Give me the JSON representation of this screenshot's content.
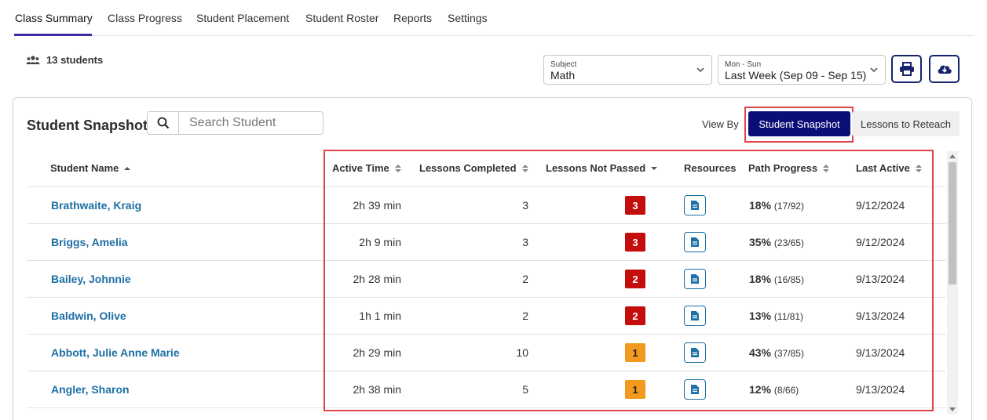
{
  "tabs": [
    {
      "label": "Class Summary",
      "active": true
    },
    {
      "label": "Class Progress"
    },
    {
      "label": "Student Placement"
    },
    {
      "label": "Student Roster"
    },
    {
      "label": "Reports"
    },
    {
      "label": "Settings"
    }
  ],
  "student_count": "13 students",
  "subject": {
    "label": "Subject",
    "value": "Math"
  },
  "range": {
    "label": "Mon - Sun",
    "value": "Last Week (Sep 09 - Sep 15)"
  },
  "icons": {
    "print": "print-icon",
    "download": "cloud-download-icon",
    "people": "people-icon",
    "search": "search-icon",
    "resource": "document-icon"
  },
  "colors": {
    "accent": "#3f2aa8",
    "primary_button": "#0c0e78",
    "link": "#1d6fa5",
    "badge_red": "#c40d0d",
    "badge_orange": "#f29a1d",
    "highlight": "#e0434b"
  },
  "snapshot": {
    "title": "Student Snapshot",
    "search_placeholder": "Search Student",
    "view_by_label": "View By",
    "view_options": [
      "Student Snapshot",
      "Lessons to Reteach"
    ],
    "active_view": "Student Snapshot",
    "columns": [
      "Student Name",
      "Active Time",
      "Lessons Completed",
      "Lessons Not Passed",
      "Resources",
      "Path Progress",
      "Last Active"
    ],
    "rows": [
      {
        "name": "Brathwaite, Kraig",
        "active_time": "2h 39 min",
        "completed": "3",
        "not_passed": "3",
        "badge": "red",
        "progress": "18%",
        "progress_frac": "(17/92)",
        "last_active": "9/12/2024"
      },
      {
        "name": "Briggs, Amelia",
        "active_time": "2h 9 min",
        "completed": "3",
        "not_passed": "3",
        "badge": "red",
        "progress": "35%",
        "progress_frac": "(23/65)",
        "last_active": "9/12/2024"
      },
      {
        "name": "Bailey, Johnnie",
        "active_time": "2h 28 min",
        "completed": "2",
        "not_passed": "2",
        "badge": "red",
        "progress": "18%",
        "progress_frac": "(16/85)",
        "last_active": "9/13/2024"
      },
      {
        "name": "Baldwin, Olive",
        "active_time": "1h 1 min",
        "completed": "2",
        "not_passed": "2",
        "badge": "red",
        "progress": "13%",
        "progress_frac": "(11/81)",
        "last_active": "9/13/2024"
      },
      {
        "name": "Abbott, Julie Anne Marie",
        "active_time": "2h 29 min",
        "completed": "10",
        "not_passed": "1",
        "badge": "orange",
        "progress": "43%",
        "progress_frac": "(37/85)",
        "last_active": "9/13/2024"
      },
      {
        "name": "Angler, Sharon",
        "active_time": "2h 38 min",
        "completed": "5",
        "not_passed": "1",
        "badge": "orange",
        "progress": "12%",
        "progress_frac": "(8/66)",
        "last_active": "9/13/2024"
      }
    ]
  }
}
